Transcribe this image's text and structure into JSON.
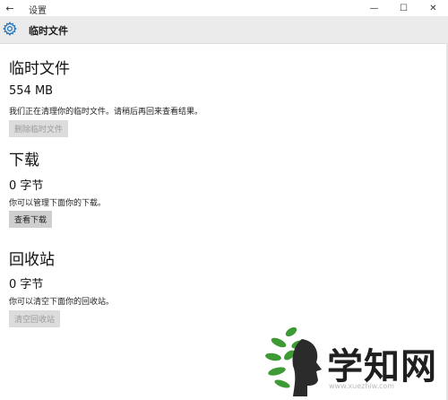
{
  "window": {
    "title": "设置",
    "back_glyph": "←",
    "controls": {
      "minimize": "—",
      "maximize": "☐",
      "close": "✕"
    }
  },
  "header": {
    "icon": "gear-icon",
    "title": "临时文件"
  },
  "sections": {
    "temp": {
      "title": "临时文件",
      "size": "554 MB",
      "description": "我们正在清理你的临时文件。请稍后再回来查看结果。",
      "button_label": "删除临时文件",
      "button_enabled": false
    },
    "downloads": {
      "title": "下载",
      "size": "0 字节",
      "description": "你可以管理下面你的下载。",
      "button_label": "查看下载",
      "button_enabled": true
    },
    "recycle": {
      "title": "回收站",
      "size": "0 字节",
      "description": "你可以清空下面你的回收站。",
      "button_label": "清空回收站",
      "button_enabled": false
    }
  },
  "watermark": {
    "logo": "leaf-head-logo",
    "text": "学知网",
    "url": "www.xuezhiw.com"
  },
  "colors": {
    "header_bg": "#ebebeb",
    "button_bg": "#cfcfcf",
    "button_disabled_bg": "#dcdcdc",
    "button_disabled_text": "#9a9a9a",
    "logo_green": "#3d9a34"
  }
}
